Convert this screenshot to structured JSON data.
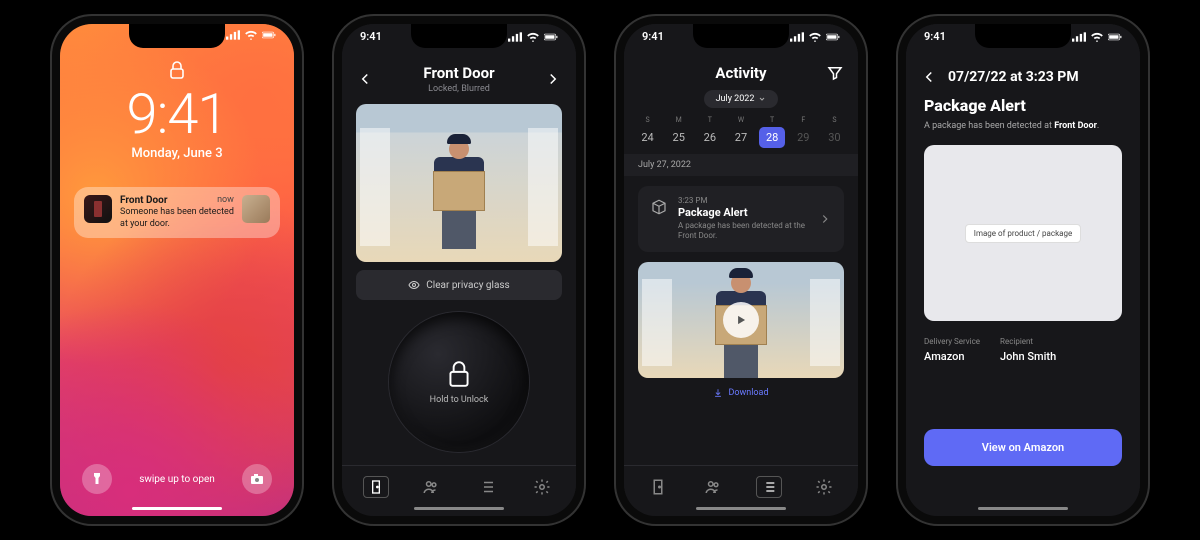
{
  "status": {
    "time": "9:41"
  },
  "phone1": {
    "time": "9:41",
    "date": "Monday, June 3",
    "notification": {
      "title": "Front Door",
      "time_label": "now",
      "message": "Someone has been detected at your door."
    },
    "swipe": "swipe up to open"
  },
  "phone2": {
    "title": "Front Door",
    "subtitle": "Locked, Blurred",
    "clear_glass": "Clear privacy glass",
    "unlock_label": "Hold to Unlock"
  },
  "phone3": {
    "title": "Activity",
    "month": "July 2022",
    "days": [
      {
        "dow": "S",
        "num": "24"
      },
      {
        "dow": "M",
        "num": "25"
      },
      {
        "dow": "T",
        "num": "26"
      },
      {
        "dow": "W",
        "num": "27"
      },
      {
        "dow": "T",
        "num": "28"
      },
      {
        "dow": "F",
        "num": "29"
      },
      {
        "dow": "S",
        "num": "30"
      }
    ],
    "section_date": "July 27, 2022",
    "item": {
      "time": "3:23 PM",
      "title": "Package Alert",
      "desc": "A package has been detected at the Front Door."
    },
    "download": "Download"
  },
  "phone4": {
    "title": "07/27/22 at 3:23 PM",
    "heading": "Package Alert",
    "sub_pre": "A package has been detected at ",
    "sub_bold": "Front Door",
    "sub_post": ".",
    "placeholder": "Image of product / package",
    "delivery_label": "Delivery Service",
    "delivery_value": "Amazon",
    "recipient_label": "Recipient",
    "recipient_value": "John Smith",
    "cta": "View on Amazon"
  }
}
